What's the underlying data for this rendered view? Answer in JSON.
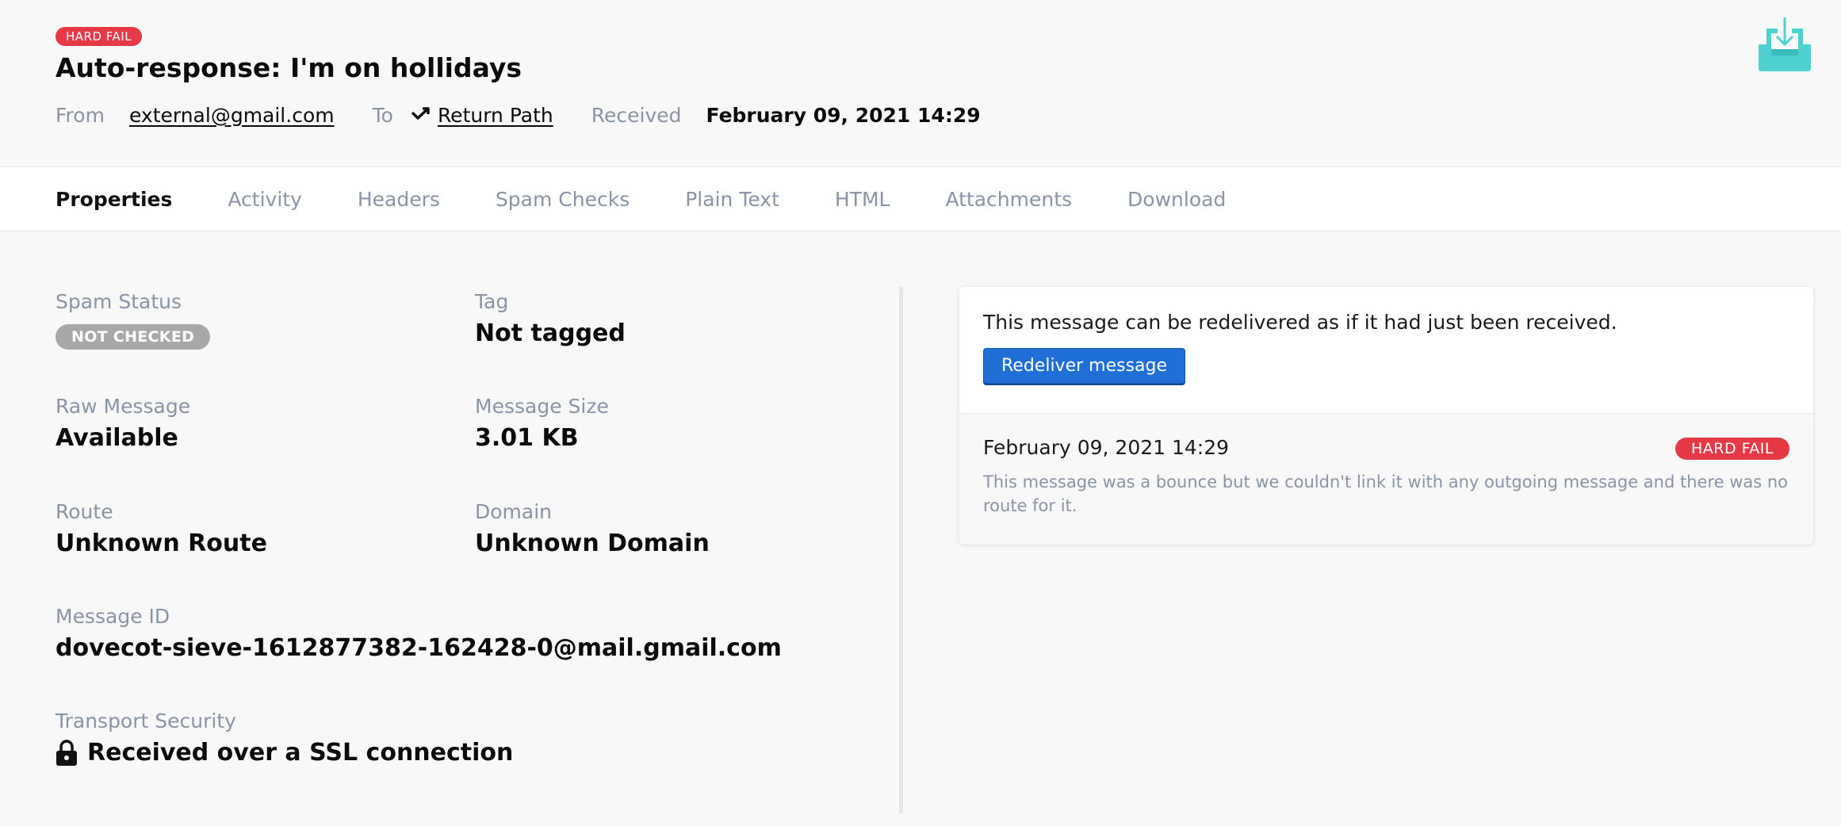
{
  "header": {
    "status_badge": "HARD FAIL",
    "title": "Auto-response: I'm on hollidays",
    "from_label": "From",
    "from_value": "external@gmail.com",
    "to_label": "To",
    "to_value": "Return Path",
    "received_label": "Received",
    "received_value": "February 09, 2021 14:29"
  },
  "tabs": [
    "Properties",
    "Activity",
    "Headers",
    "Spam Checks",
    "Plain Text",
    "HTML",
    "Attachments",
    "Download"
  ],
  "active_tab": "Properties",
  "properties": {
    "spam_status_label": "Spam Status",
    "spam_status_value": "NOT CHECKED",
    "tag_label": "Tag",
    "tag_value": "Not tagged",
    "raw_message_label": "Raw Message",
    "raw_message_value": "Available",
    "message_size_label": "Message Size",
    "message_size_value": "3.01 KB",
    "route_label": "Route",
    "route_value": "Unknown Route",
    "domain_label": "Domain",
    "domain_value": "Unknown Domain",
    "message_id_label": "Message ID",
    "message_id_value": "dovecot-sieve-1612877382-162428-0@mail.gmail.com",
    "transport_label": "Transport Security",
    "transport_value": "Received over a SSL connection"
  },
  "redeliver": {
    "text": "This message can be redelivered as if it had just been received.",
    "button": "Redeliver message"
  },
  "activity": {
    "date": "February 09, 2021 14:29",
    "badge": "HARD FAIL",
    "description": "This message was a bounce but we couldn't link it with any outgoing message and there was no route for it."
  },
  "colors": {
    "fail": "#e63946",
    "primary_button": "#1f6fd6",
    "muted_text": "#8a94a4",
    "accent_teal": "#4fd1d0"
  },
  "icons": {
    "return_path": "return-path-icon",
    "inbox": "inbox-download-icon",
    "lock": "lock-icon"
  }
}
